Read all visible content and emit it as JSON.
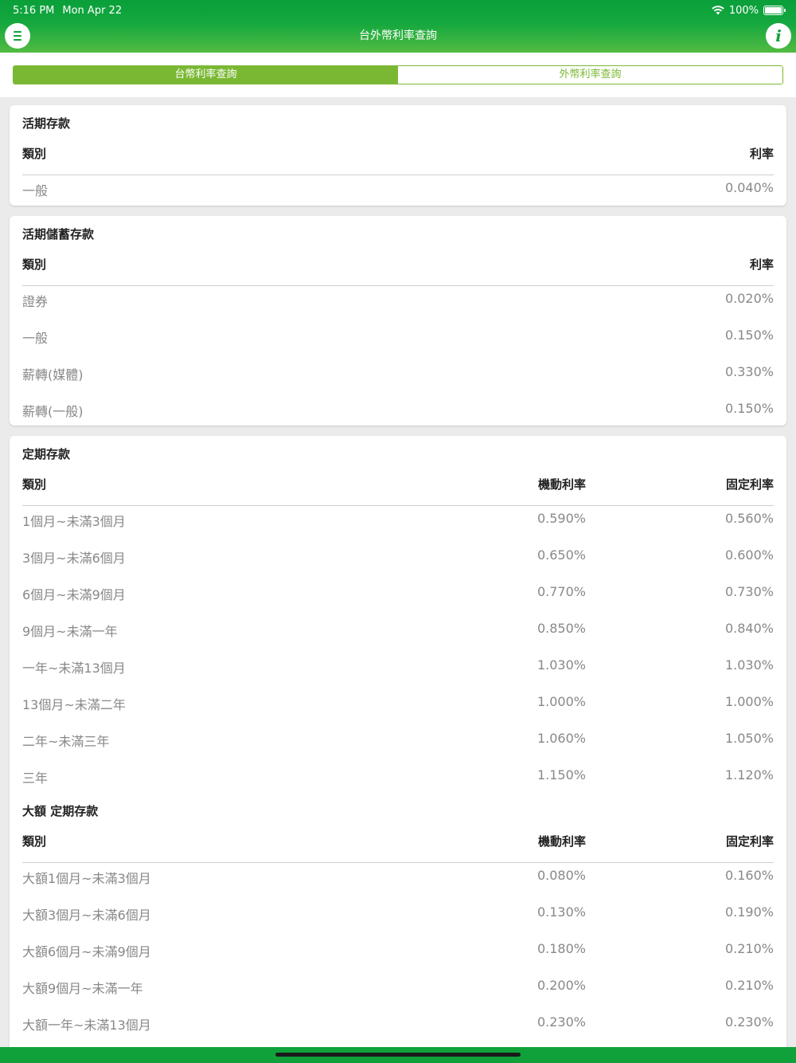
{
  "status": {
    "time": "5:16 PM",
    "date": "Mon Apr 22",
    "battery": "100%"
  },
  "nav": {
    "title": "台外幣利率查詢"
  },
  "tabs": [
    {
      "label": "台幣利率查詢",
      "active": true
    },
    {
      "label": "外幣利率查詢",
      "active": false
    }
  ],
  "demand": {
    "title": "活期存款",
    "header": {
      "name": "類別",
      "rate": "利率"
    },
    "rows": [
      {
        "name": "一般",
        "rate": "0.040%"
      }
    ]
  },
  "savings": {
    "title": "活期儲蓄存款",
    "header": {
      "name": "類別",
      "rate": "利率"
    },
    "rows": [
      {
        "name": "證券",
        "rate": "0.020%"
      },
      {
        "name": "一般",
        "rate": "0.150%"
      },
      {
        "name": "薪轉(媒體)",
        "rate": "0.330%"
      },
      {
        "name": "薪轉(一般)",
        "rate": "0.150%"
      }
    ]
  },
  "time_deposit": {
    "title": "定期存款",
    "header": {
      "name": "類別",
      "floating": "機動利率",
      "fixed": "固定利率"
    },
    "rows": [
      {
        "name": "1個月~未滿3個月",
        "floating": "0.590%",
        "fixed": "0.560%"
      },
      {
        "name": "3個月~未滿6個月",
        "floating": "0.650%",
        "fixed": "0.600%"
      },
      {
        "name": "6個月~未滿9個月",
        "floating": "0.770%",
        "fixed": "0.730%"
      },
      {
        "name": "9個月~未滿一年",
        "floating": "0.850%",
        "fixed": "0.840%"
      },
      {
        "name": "一年~未滿13個月",
        "floating": "1.030%",
        "fixed": "1.030%"
      },
      {
        "name": "13個月~未滿二年",
        "floating": "1.000%",
        "fixed": "1.000%"
      },
      {
        "name": "二年~未滿三年",
        "floating": "1.060%",
        "fixed": "1.050%"
      },
      {
        "name": "三年",
        "floating": "1.150%",
        "fixed": "1.120%"
      }
    ]
  },
  "large_deposit": {
    "title": "大額 定期存款",
    "header": {
      "name": "類別",
      "floating": "機動利率",
      "fixed": "固定利率"
    },
    "rows": [
      {
        "name": "大額1個月~未滿3個月",
        "floating": "0.080%",
        "fixed": "0.160%"
      },
      {
        "name": "大額3個月~未滿6個月",
        "floating": "0.130%",
        "fixed": "0.190%"
      },
      {
        "name": "大額6個月~未滿9個月",
        "floating": "0.180%",
        "fixed": "0.210%"
      },
      {
        "name": "大額9個月~未滿一年",
        "floating": "0.200%",
        "fixed": "0.210%"
      },
      {
        "name": "大額一年~未滿13個月",
        "floating": "0.230%",
        "fixed": "0.230%"
      }
    ]
  },
  "colors": {
    "brand_green": "#10a13a",
    "segment_green": "#7ab833"
  },
  "icons": {
    "menu": "hamburger-icon",
    "info": "info-icon",
    "wifi": "wifi-icon",
    "battery": "battery-icon"
  }
}
